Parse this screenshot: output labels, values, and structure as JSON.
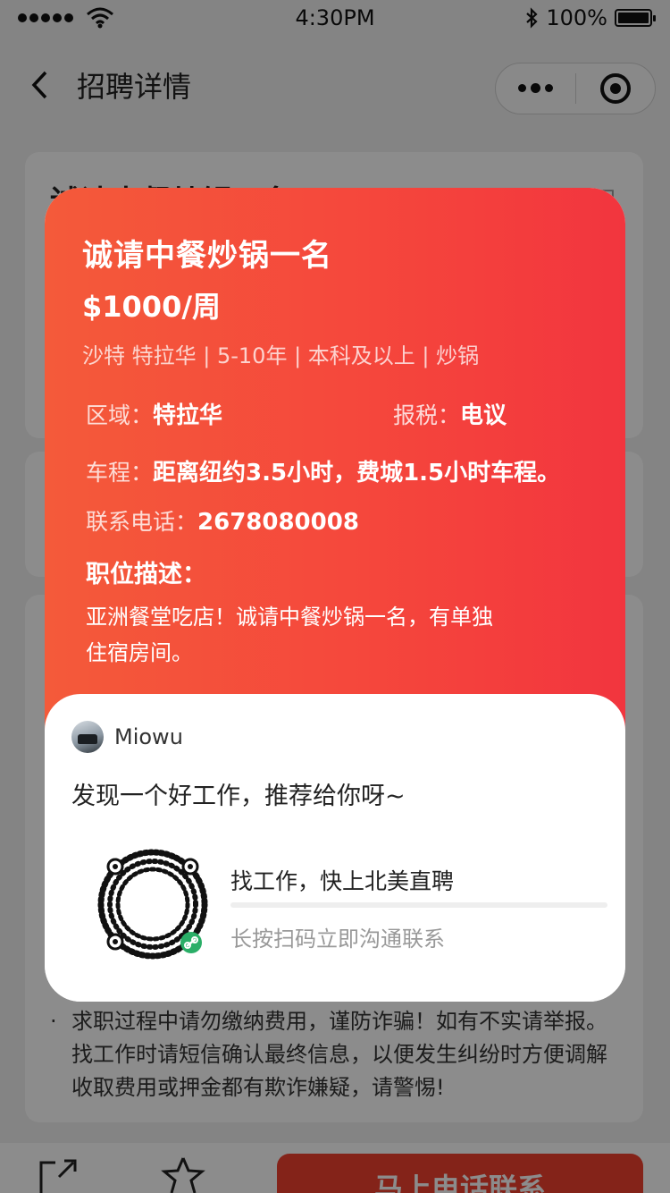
{
  "status_bar": {
    "time": "4:30PM",
    "battery_text": "100%",
    "battery_level": 1.0
  },
  "nav": {
    "title": "招聘详情"
  },
  "background": {
    "card_title": "诚请中餐炒锅一名",
    "card_tag": "周",
    "notice_lines": [
      "求职过程中请勿缴纳费用，谨防诈骗！如有不实请举报。",
      "找工作时请短信确认最终信息，以便发生纠纷时方便调解",
      "收取费用或押金都有欺诈嫌疑，请警惕!"
    ],
    "call_button": "马上电话联系"
  },
  "poster": {
    "job_title": "诚请中餐炒锅一名",
    "salary": "$1000/周",
    "meta": "沙特 特拉华 | 5-10年 | 本科及以上 | 炒锅",
    "region_label": "区域：",
    "region_value": "特拉华",
    "tax_label": "报税：",
    "tax_value": "电议",
    "commute_label": "车程：",
    "commute_value": "距离纽约3.5小时，费城1.5小时车程。",
    "phone_label": "联系电话：",
    "phone_value": "2678080008",
    "desc_title": "职位描述：",
    "desc_line1": "亚洲餐堂吃店！诚请中餐炒锅一名，有单独",
    "desc_line2": "住宿房间。",
    "sharer_name": "Miowu",
    "share_message": "发现一个好工作，推荐给你呀~",
    "qr_title": "找工作，快上北美直聘",
    "qr_subtitle": "长按扫码立即沟通联系"
  },
  "colors": {
    "poster_gradient_start": "#f45a3a",
    "poster_gradient_end": "#f2353e",
    "call_button": "#f0402e",
    "wechat_green": "#2aae67"
  }
}
